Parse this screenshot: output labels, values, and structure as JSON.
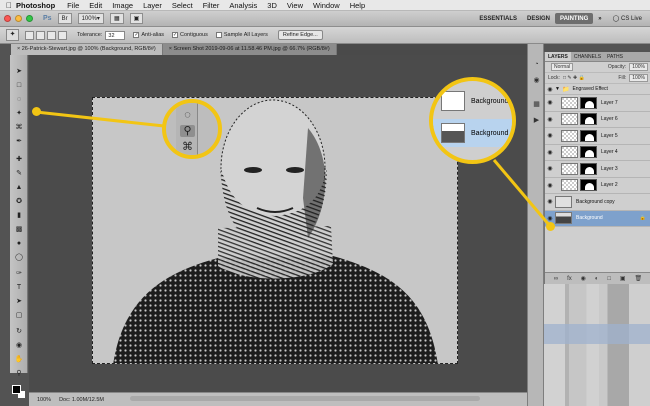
{
  "menubar": {
    "app": "Photoshop",
    "items": [
      "File",
      "Edit",
      "Image",
      "Layer",
      "Select",
      "Filter",
      "Analysis",
      "3D",
      "View",
      "Window",
      "Help"
    ]
  },
  "appbar": {
    "logo": "Ps",
    "zoom": "100%",
    "workspaces": [
      "ESSENTIALS",
      "DESIGN",
      "PAINTING"
    ],
    "active_workspace": "PAINTING",
    "more": "»",
    "cslive": "CS Live"
  },
  "options": {
    "tolerance_label": "Tolerance:",
    "tolerance_value": "32",
    "anti_alias": "Anti-alias",
    "contiguous": "Contiguous",
    "sample_all": "Sample All Layers",
    "refine": "Refine Edge..."
  },
  "tabs": [
    "26-Patrick-Stewart.jpg @ 100% (Background, RGB/8#)",
    "Screen Shot 2019-09-06 at 11.58.46 PM.jpg @ 66.7% (RGB/8#)"
  ],
  "status": {
    "zoom": "100%",
    "doc": "Doc: 1.00M/12.5M"
  },
  "layers_panel": {
    "tabs": [
      "LAYERS",
      "CHANNELS",
      "PATHS"
    ],
    "blend_mode": "Normal",
    "opacity_label": "Opacity:",
    "opacity_value": "100%",
    "lock_label": "Lock:",
    "fill_label": "Fill:",
    "fill_value": "100%",
    "group_name": "Engraved Effect",
    "layers": [
      "Layer 7",
      "Layer 6",
      "Layer 5",
      "Layer 4",
      "Layer 3",
      "Layer 2"
    ],
    "copy_layer": "Background copy",
    "background": "Background"
  },
  "callout2": {
    "row1": "Background",
    "row2": "Background"
  },
  "colors": {
    "callout": "#f2c514",
    "selected_layer": "#7ea1cc"
  }
}
